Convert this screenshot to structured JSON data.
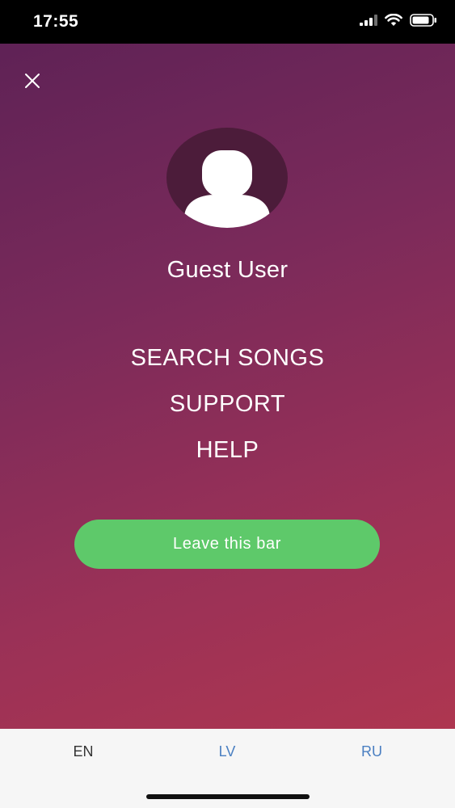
{
  "status_bar": {
    "time": "17:55",
    "icons": [
      "signal-icon",
      "wifi-icon",
      "battery-icon"
    ]
  },
  "menu": {
    "close_icon": "close-icon",
    "avatar_icon": "user-avatar-icon",
    "user_name": "Guest User",
    "items": [
      {
        "label": "SEARCH SONGS"
      },
      {
        "label": "SUPPORT"
      },
      {
        "label": "HELP"
      }
    ],
    "leave_button": "Leave this bar"
  },
  "languages": [
    {
      "code": "EN",
      "active": true
    },
    {
      "code": "LV",
      "active": false
    },
    {
      "code": "RU",
      "active": false
    }
  ],
  "colors": {
    "gradient_top": "#5f2256",
    "gradient_bottom": "#ae3650",
    "leave_button": "#5ec96a",
    "language_link": "#4a7fc1"
  }
}
